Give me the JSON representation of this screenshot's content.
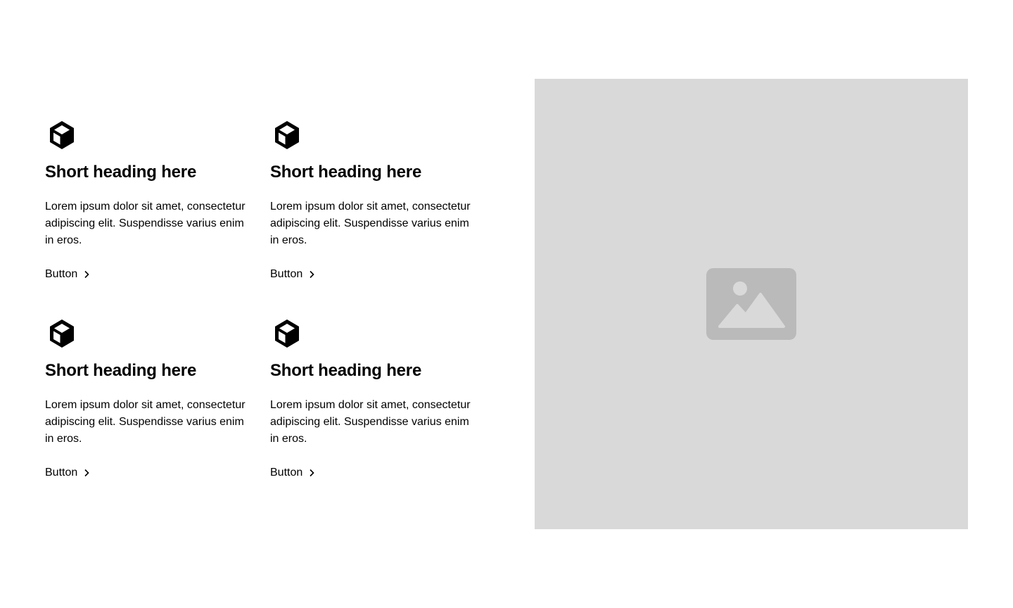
{
  "features": [
    {
      "icon": "cube-icon",
      "heading": "Short heading here",
      "text": "Lorem ipsum dolor sit amet, consectetur adipiscing elit. Suspendisse varius enim in eros.",
      "button_label": "Button"
    },
    {
      "icon": "cube-icon",
      "heading": "Short heading here",
      "text": "Lorem ipsum dolor sit amet, consectetur adipiscing elit. Suspendisse varius enim in eros.",
      "button_label": "Button"
    },
    {
      "icon": "cube-icon",
      "heading": "Short heading here",
      "text": "Lorem ipsum dolor sit amet, consectetur adipiscing elit. Suspendisse varius enim in eros.",
      "button_label": "Button"
    },
    {
      "icon": "cube-icon",
      "heading": "Short heading here",
      "text": "Lorem ipsum dolor sit amet, consectetur adipiscing elit. Suspendisse varius enim in eros.",
      "button_label": "Button"
    }
  ],
  "image": {
    "icon": "image-placeholder-icon",
    "background_color": "#d9d9d9",
    "icon_color": "#bababa"
  }
}
